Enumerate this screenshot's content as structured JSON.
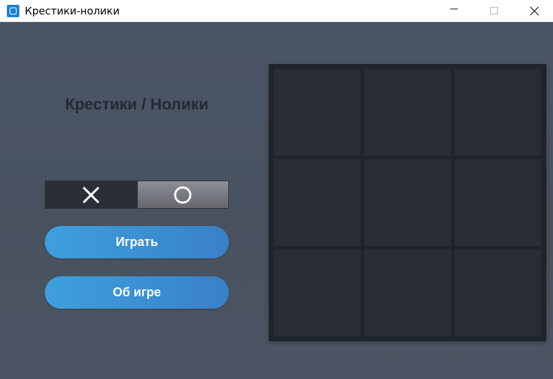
{
  "window": {
    "title": "Крестики-нолики",
    "icon": "app-icon",
    "controls": [
      "minimize-icon",
      "maximize-icon",
      "close-icon"
    ]
  },
  "main": {
    "heading": "Крестики / Нолики",
    "selector": {
      "options": [
        {
          "symbol": "X",
          "icon": "cross-icon",
          "selected": true
        },
        {
          "symbol": "O",
          "icon": "circle-icon",
          "selected": false
        }
      ]
    },
    "play_label": "Играть",
    "about_label": "Об игре"
  },
  "board": {
    "rows": 3,
    "cols": 3,
    "cells": [
      "",
      "",
      "",
      "",
      "",
      "",
      "",
      "",
      ""
    ]
  },
  "colors": {
    "accent": "#3a8fd2",
    "board": "#272c37",
    "background": "#4a5466"
  }
}
